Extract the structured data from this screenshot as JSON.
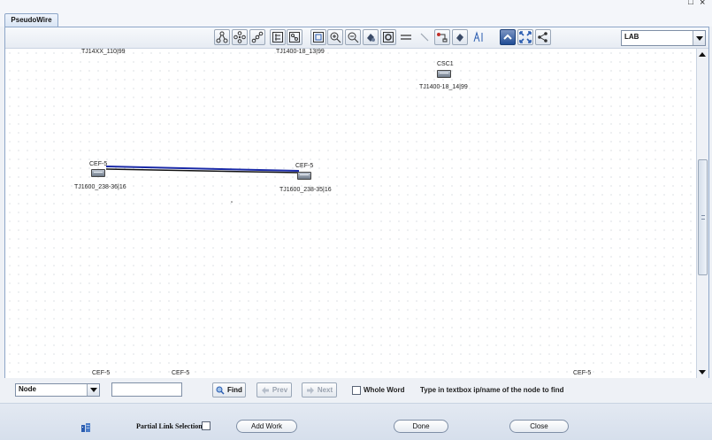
{
  "window": {
    "maximize_glyph": "□",
    "close_glyph": "×"
  },
  "tab": {
    "label": "PseudoWire"
  },
  "toolbar": {
    "icons": [
      "layout-tree-icon",
      "layout-circle-icon",
      "layout-hierarchy-icon",
      "layout-grid-icon",
      "layout-organic-icon",
      "fit-view-icon",
      "zoom-in-icon",
      "zoom-out-icon",
      "pan-icon",
      "zoom-box-icon",
      "straight-link-icon",
      "link-tool-icon",
      "node-tool-icon",
      "select-tool-icon",
      "text-tool-icon",
      "collapse-icon",
      "expand-icon",
      "share-icon"
    ],
    "view_select": {
      "value": "LAB"
    }
  },
  "canvas": {
    "labels": {
      "top_left": "TJ14XX_110|99",
      "top_mid": "TJ1400-18_13|99",
      "bottom_1": "CEF-5",
      "bottom_2": "CEF-5",
      "bottom_3": "CEF-5"
    },
    "nodes": [
      {
        "name": "CSC1",
        "label": "TJ1400-18_14|99"
      },
      {
        "name": "CEF-5",
        "label": "TJ1600_238-36|16"
      },
      {
        "name": "CEF-5",
        "label": "TJ1600_238-35|16"
      }
    ],
    "link_colors": {
      "primary": "#1a2aa8",
      "secondary": "#111111"
    }
  },
  "findbar": {
    "type_select": {
      "value": "Node"
    },
    "search_input": {
      "value": ""
    },
    "find_label": "Find",
    "prev_label": "Prev",
    "next_label": "Next",
    "whole_word_label": "Whole Word",
    "hint": "Type in textbox ip/name of the node to find"
  },
  "bottombar": {
    "partial_link_label": "Partial Link Selection",
    "add_work_label": "Add Work",
    "done_label": "Done",
    "close_label": "Close"
  }
}
